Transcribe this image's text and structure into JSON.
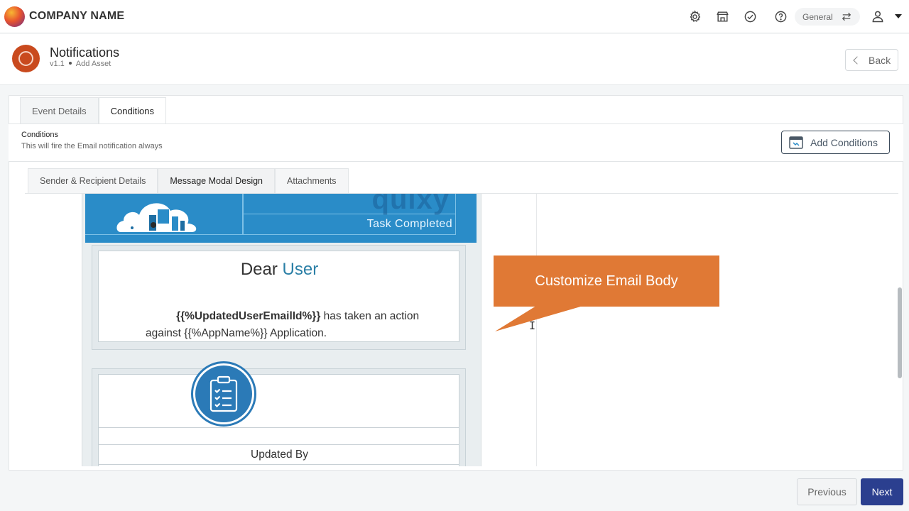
{
  "header": {
    "company_name": "COMPANY NAME",
    "icons": [
      "gear-icon",
      "store-icon",
      "check-circle-icon",
      "help-icon",
      "swap-icon",
      "user-icon"
    ],
    "workspace": "General"
  },
  "page": {
    "title": "Notifications",
    "version": "v1.1",
    "subtitle": "Add Asset",
    "back_label": "Back"
  },
  "tabs": [
    {
      "label": "Event Details",
      "active": false
    },
    {
      "label": "Conditions",
      "active": true
    }
  ],
  "conditions": {
    "title": "Conditions",
    "description": "This will fire the Email notification always",
    "add_button": "Add Conditions"
  },
  "subtabs": [
    {
      "label": "Sender & Recipient Details",
      "active": false
    },
    {
      "label": "Message Modal Design",
      "active": true
    },
    {
      "label": "Attachments",
      "active": false
    }
  ],
  "email": {
    "brand": "quixy",
    "banner_status": "Task Completed",
    "greeting": "Dear",
    "greeting_name": "User",
    "placeholder_user": "{{%UpdatedUserEmailId%}}",
    "message_mid": " has taken an action against ",
    "placeholder_app": "{{%AppName%}}",
    "message_end": " Application.",
    "updated_by": "Updated By"
  },
  "callout": {
    "text": "Customize Email Body",
    "color": "#e07935"
  },
  "footer": {
    "previous_label": "Previous",
    "next_label": "Next",
    "accent": "#2b3f8f"
  }
}
